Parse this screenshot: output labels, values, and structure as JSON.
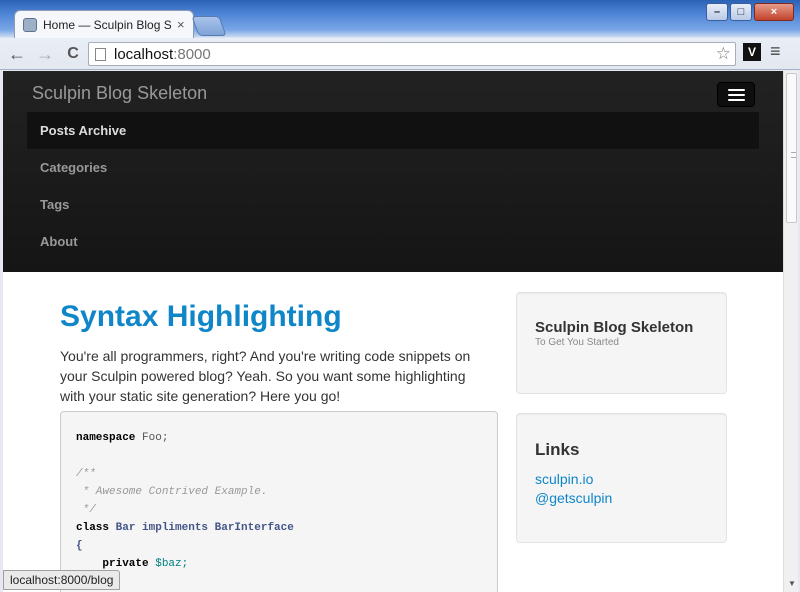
{
  "browser": {
    "tab_title": "Home — Sculpin Blog Ske",
    "tab_close": "×",
    "url_host": "localhost",
    "url_port": ":8000",
    "back_icon": "←",
    "forward_icon": "→",
    "reload_icon": "C",
    "star_icon": "☆",
    "extension_label": "V",
    "menu_icon": "≡",
    "window_buttons": {
      "minimize": "–",
      "maximize": "□",
      "close": "×"
    },
    "status_url": "localhost:8000/blog"
  },
  "navbar": {
    "brand": "Sculpin Blog Skeleton",
    "items": [
      {
        "label": "Posts Archive",
        "active": true
      },
      {
        "label": "Categories"
      },
      {
        "label": "Tags"
      },
      {
        "label": "About"
      }
    ]
  },
  "post": {
    "title": "Syntax Highlighting",
    "intro": "You're all programmers, right? And you're writing code snippets on your Sculpin powered blog? Yeah. So you want some highlighting with your static site generation? Here you go!"
  },
  "code": {
    "l1_kw": "namespace",
    "l1_rest": " Foo;",
    "l3": "/**",
    "l4": " * Awesome Contrived Example.",
    "l5": " */",
    "l6_kw": "class",
    "l6_name": " Bar impliments BarInterface",
    "l7": "{",
    "l8_kw": "    private",
    "l8_var": " $baz;"
  },
  "sidebar": {
    "title": "Sculpin Blog Skeleton",
    "tagline": "To Get You Started",
    "links_title": "Links",
    "links": [
      "sculpin.io",
      "@getsculpin"
    ]
  },
  "colors": {
    "link": "#0e86c8",
    "navbar_bg": "#1b1b1b"
  }
}
